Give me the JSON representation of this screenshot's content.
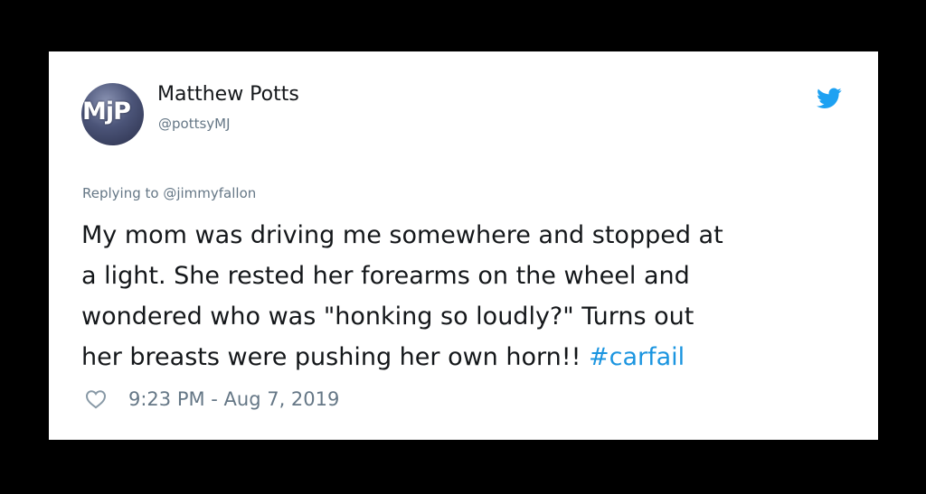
{
  "tweet": {
    "avatar_initials": "MjP",
    "display_name": "Matthew Potts",
    "handle": "@pottsyMJ",
    "replying_to": "Replying to @jimmyfallon",
    "text_lines": [
      "My mom was driving me somewhere and stopped at",
      "a light. She rested her forearms on the wheel and",
      "wondered who was \"honking so loudly?\"  Turns out",
      "her breasts were pushing her own horn!! "
    ],
    "hashtag": "#carfail",
    "timestamp": "9:23 PM - Aug 7, 2019"
  },
  "icons": {
    "platform": "twitter-bird-icon",
    "like": "heart-outline-icon"
  },
  "colors": {
    "background": "#000000",
    "card": "#ffffff",
    "text": "#14171a",
    "muted": "#657786",
    "accent": "#1b95e0"
  }
}
